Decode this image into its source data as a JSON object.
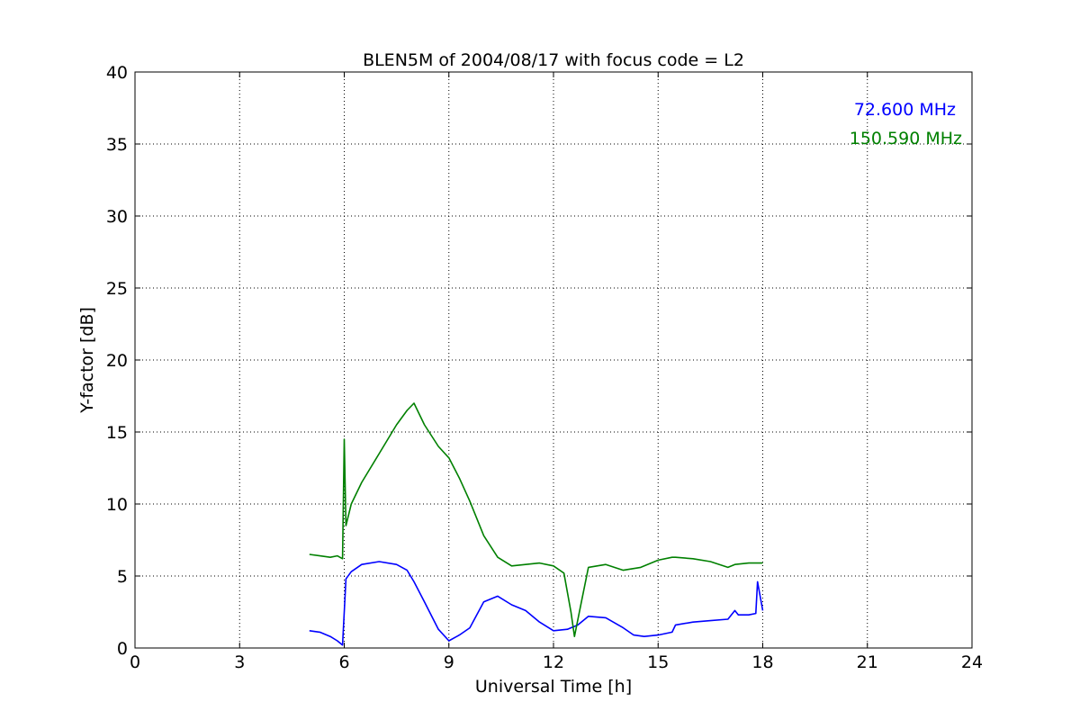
{
  "chart_data": {
    "type": "line",
    "title": "BLEN5M of 2004/08/17 with focus code = L2",
    "xlabel": "Universal Time [h]",
    "ylabel": "Y-factor [dB]",
    "xlim": [
      0,
      24
    ],
    "ylim": [
      0,
      40
    ],
    "x_ticks": [
      "0",
      "3",
      "6",
      "9",
      "12",
      "15",
      "18",
      "21",
      "24"
    ],
    "y_ticks": [
      "0",
      "5",
      "10",
      "15",
      "20",
      "25",
      "30",
      "35",
      "40"
    ],
    "grid": true,
    "legend_placement": "top-right",
    "series": [
      {
        "name": "72.600 MHz",
        "color": "#0000ff",
        "x": [
          5.0,
          5.3,
          5.6,
          5.8,
          5.95,
          6.05,
          6.2,
          6.5,
          7.0,
          7.5,
          7.8,
          8.0,
          8.3,
          8.7,
          9.0,
          9.3,
          9.6,
          10.0,
          10.4,
          10.8,
          11.2,
          11.6,
          12.0,
          12.4,
          12.7,
          13.0,
          13.5,
          14.0,
          14.3,
          14.6,
          15.0,
          15.4,
          15.5,
          16.0,
          16.5,
          17.0,
          17.2,
          17.3,
          17.6,
          17.8,
          17.85,
          18.0
        ],
        "y": [
          1.2,
          1.1,
          0.8,
          0.5,
          0.2,
          4.8,
          5.3,
          5.8,
          6.0,
          5.8,
          5.4,
          4.6,
          3.2,
          1.3,
          0.5,
          0.9,
          1.4,
          3.2,
          3.6,
          3.0,
          2.6,
          1.8,
          1.2,
          1.3,
          1.6,
          2.2,
          2.1,
          1.4,
          0.9,
          0.8,
          0.9,
          1.1,
          1.6,
          1.8,
          1.9,
          2.0,
          2.6,
          2.3,
          2.3,
          2.4,
          4.6,
          2.6
        ]
      },
      {
        "name": "150.590 MHz",
        "color": "#008000",
        "x": [
          5.0,
          5.3,
          5.6,
          5.8,
          5.95,
          6.0,
          6.05,
          6.2,
          6.5,
          7.0,
          7.5,
          7.8,
          8.0,
          8.3,
          8.7,
          9.0,
          9.3,
          9.6,
          10.0,
          10.4,
          10.8,
          11.2,
          11.6,
          12.0,
          12.3,
          12.5,
          12.6,
          12.8,
          13.0,
          13.5,
          14.0,
          14.5,
          15.0,
          15.4,
          15.5,
          16.0,
          16.5,
          17.0,
          17.2,
          17.6,
          18.0
        ],
        "y": [
          6.5,
          6.4,
          6.3,
          6.4,
          6.2,
          14.5,
          8.5,
          10.0,
          11.5,
          13.5,
          15.5,
          16.5,
          17.0,
          15.5,
          14.0,
          13.2,
          11.8,
          10.2,
          7.8,
          6.3,
          5.7,
          5.8,
          5.9,
          5.7,
          5.2,
          2.5,
          0.8,
          3.2,
          5.6,
          5.8,
          5.4,
          5.6,
          6.1,
          6.3,
          6.3,
          6.2,
          6.0,
          5.6,
          5.8,
          5.9,
          5.9
        ]
      }
    ]
  }
}
